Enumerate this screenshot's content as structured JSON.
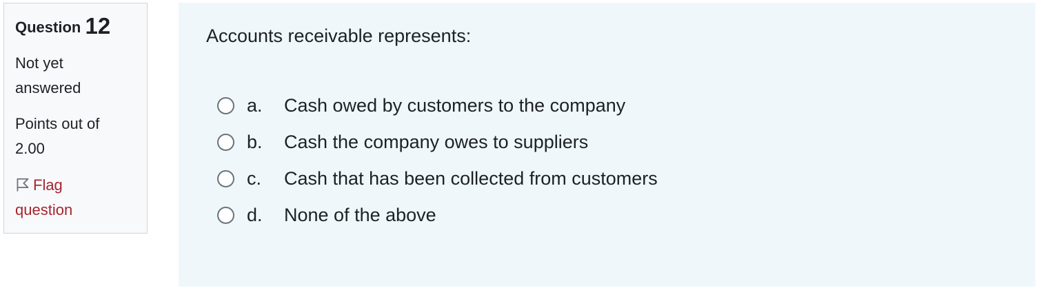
{
  "question_info": {
    "title_label": "Question",
    "number": "12",
    "state_line1": "Not yet",
    "state_line2": "answered",
    "grade_line1": "Points out of",
    "grade_line2": "2.00",
    "flag_line1": "Flag",
    "flag_line2": "question",
    "flag_icon": "flag-outline-icon"
  },
  "question": {
    "text": "Accounts receivable represents:",
    "options": [
      {
        "letter": "a.",
        "text": "Cash owed by customers to the company",
        "selected": false
      },
      {
        "letter": "b.",
        "text": "Cash the company owes to suppliers",
        "selected": false
      },
      {
        "letter": "c.",
        "text": "Cash that has been collected from customers",
        "selected": false
      },
      {
        "letter": "d.",
        "text": "None of the above",
        "selected": false
      }
    ]
  },
  "colors": {
    "info_bg": "#f8f9fa",
    "content_bg": "#eff7fb",
    "flag_text": "#a4262f",
    "text": "#1d2125"
  }
}
